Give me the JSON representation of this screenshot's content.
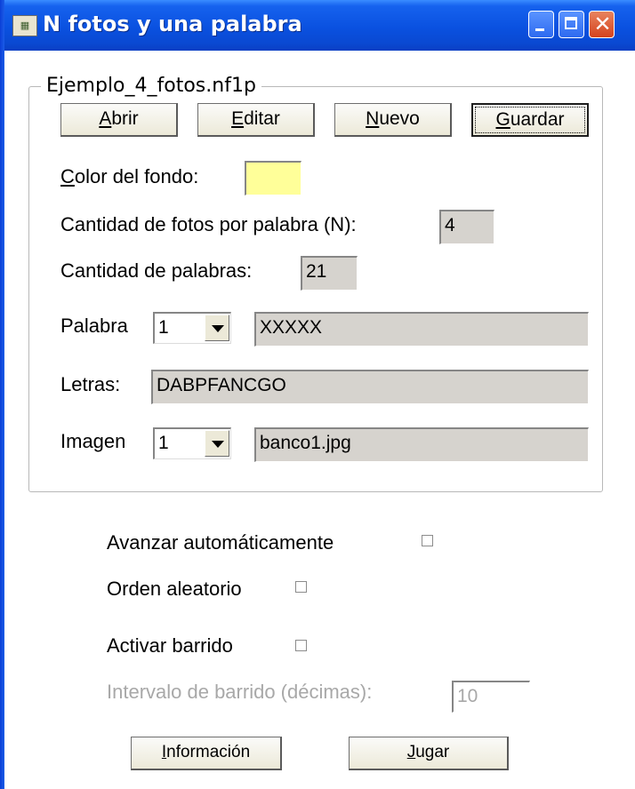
{
  "window": {
    "title": "N fotos y una palabra",
    "icon": "app-icon",
    "accent": "#0a51e0"
  },
  "group": {
    "legend": "Ejemplo_4_fotos.nf1p"
  },
  "toolbar": {
    "abrir": {
      "mn": "A",
      "rest": "brir"
    },
    "editar": {
      "mn": "E",
      "rest": "ditar"
    },
    "nuevo": {
      "mn": "N",
      "rest": "uevo"
    },
    "guardar": {
      "mn": "G",
      "rest": "uardar"
    }
  },
  "fields": {
    "bg_color_label_mn": "C",
    "bg_color_label_rest": "olor del fondo:",
    "bg_color_value": "#ffff99",
    "n_label": "Cantidad de fotos por palabra (N):",
    "n_value": "4",
    "words_label": "Cantidad de palabras:",
    "words_value": "21",
    "word_label": "Palabra",
    "word_index": "1",
    "word_value": "XXXXX",
    "letters_label": "Letras:",
    "letters_value": "DABPFANCGO",
    "image_label": "Imagen",
    "image_index": "1",
    "image_value": "banco1.jpg"
  },
  "options": {
    "auto_advance": "Avanzar automáticamente",
    "random_order": "Orden aleatorio",
    "scan": "Activar barrido",
    "interval_label": "Intervalo de barrido (décimas):",
    "interval_value": "10"
  },
  "footer": {
    "info": {
      "mn": "I",
      "rest": "nformación"
    },
    "play": {
      "mn": "J",
      "rest": "ugar"
    }
  }
}
